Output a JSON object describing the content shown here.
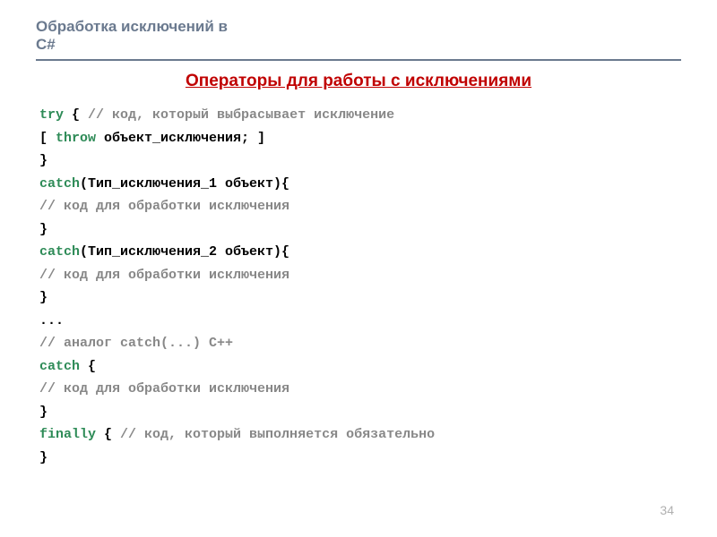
{
  "header": "Обработка исключений в C#",
  "title": " Операторы для работы с исключениями",
  "code": {
    "l1_kw": "try",
    "l1_rest": " { ",
    "l1_comment": "// код, который выбрасывает исключение",
    "l2_indent": "    [ ",
    "l2_kw": "throw",
    "l2_rest": " объект_исключения; ]",
    "l3": "}",
    "l4_kw": "catch",
    "l4_rest": "(Тип_исключения_1 объект){",
    "l5_indent": "    ",
    "l5_comment": "// код для обработки исключения",
    "l6": "}",
    "l7_kw": "catch",
    "l7_rest": "(Тип_исключения_2 объект){",
    "l8_indent": "    ",
    "l8_comment": "// код для обработки исключения",
    "l9": "}",
    "l10": "...",
    "l11_comment": "// аналог catch(...) C++",
    "l12_kw": "catch",
    "l12_rest": " {",
    "l13_indent": "    ",
    "l13_comment": "// код для обработки исключения",
    "l14": "}",
    "l15_kw": "finally",
    "l15_rest": " { ",
    "l15_comment": "// код, который выполняется обязательно",
    "l16": "}"
  },
  "page_number": "34"
}
